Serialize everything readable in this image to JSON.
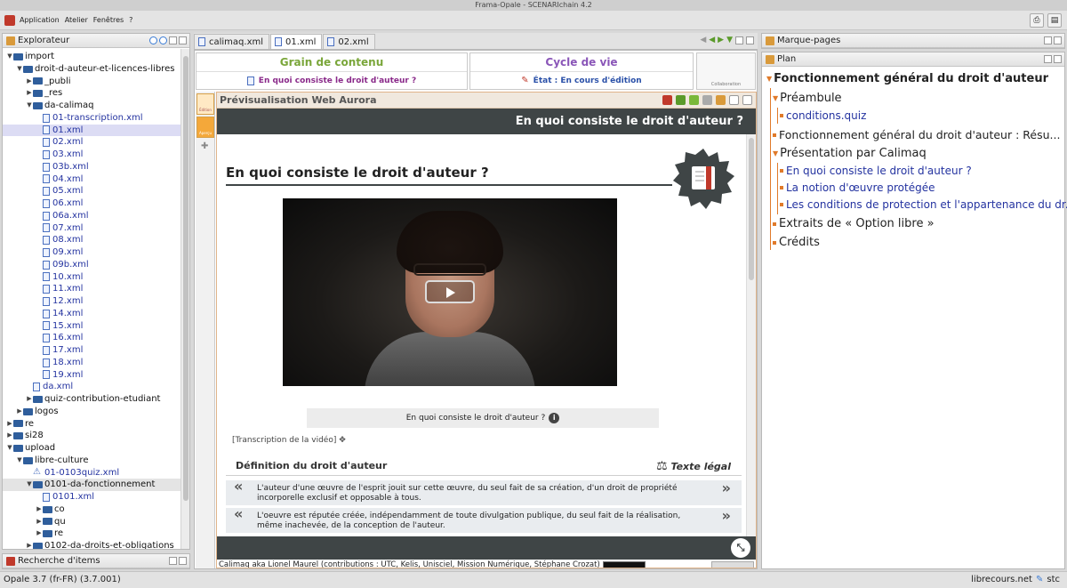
{
  "window": {
    "title": "Frama-Opale - SCENARIchain 4.2"
  },
  "menu": {
    "items": [
      "Application",
      "Atelier",
      "Fenêtres",
      "?"
    ]
  },
  "explorer": {
    "title": "Explorateur",
    "tree": [
      {
        "label": "import",
        "depth": 0,
        "type": "dir",
        "open": true
      },
      {
        "label": "droit-d-auteur-et-licences-libres",
        "depth": 1,
        "type": "dir",
        "open": true
      },
      {
        "label": "_publi",
        "depth": 2,
        "type": "dir",
        "open": false
      },
      {
        "label": "_res",
        "depth": 2,
        "type": "dir",
        "open": false
      },
      {
        "label": "da-calimaq",
        "depth": 2,
        "type": "dir",
        "open": true
      },
      {
        "label": "01-transcription.xml",
        "depth": 3,
        "type": "file"
      },
      {
        "label": "01.xml",
        "depth": 3,
        "type": "file",
        "selected": true
      },
      {
        "label": "02.xml",
        "depth": 3,
        "type": "file"
      },
      {
        "label": "03.xml",
        "depth": 3,
        "type": "file"
      },
      {
        "label": "03b.xml",
        "depth": 3,
        "type": "file"
      },
      {
        "label": "04.xml",
        "depth": 3,
        "type": "file"
      },
      {
        "label": "05.xml",
        "depth": 3,
        "type": "file"
      },
      {
        "label": "06.xml",
        "depth": 3,
        "type": "file"
      },
      {
        "label": "06a.xml",
        "depth": 3,
        "type": "file"
      },
      {
        "label": "07.xml",
        "depth": 3,
        "type": "file"
      },
      {
        "label": "08.xml",
        "depth": 3,
        "type": "file"
      },
      {
        "label": "09.xml",
        "depth": 3,
        "type": "file"
      },
      {
        "label": "09b.xml",
        "depth": 3,
        "type": "file"
      },
      {
        "label": "10.xml",
        "depth": 3,
        "type": "file"
      },
      {
        "label": "11.xml",
        "depth": 3,
        "type": "file"
      },
      {
        "label": "12.xml",
        "depth": 3,
        "type": "file"
      },
      {
        "label": "14.xml",
        "depth": 3,
        "type": "file"
      },
      {
        "label": "15.xml",
        "depth": 3,
        "type": "file"
      },
      {
        "label": "16.xml",
        "depth": 3,
        "type": "file"
      },
      {
        "label": "17.xml",
        "depth": 3,
        "type": "file"
      },
      {
        "label": "18.xml",
        "depth": 3,
        "type": "file"
      },
      {
        "label": "19.xml",
        "depth": 3,
        "type": "file"
      },
      {
        "label": "da.xml",
        "depth": 2,
        "type": "file"
      },
      {
        "label": "quiz-contribution-etudiant",
        "depth": 2,
        "type": "dir",
        "open": false
      },
      {
        "label": "logos",
        "depth": 1,
        "type": "dir",
        "open": false
      },
      {
        "label": "re",
        "depth": 0,
        "type": "dir",
        "open": false
      },
      {
        "label": "si28",
        "depth": 0,
        "type": "dir",
        "open": false
      },
      {
        "label": "upload",
        "depth": 0,
        "type": "dir",
        "open": true
      },
      {
        "label": "libre-culture",
        "depth": 1,
        "type": "dir",
        "open": true
      },
      {
        "label": "01-0103quiz.xml",
        "depth": 2,
        "type": "quiz"
      },
      {
        "label": "0101-da-fonctionnement",
        "depth": 2,
        "type": "dir",
        "open": true,
        "hover": true
      },
      {
        "label": "0101.xml",
        "depth": 3,
        "type": "file"
      },
      {
        "label": "co",
        "depth": 3,
        "type": "dir",
        "open": false
      },
      {
        "label": "qu",
        "depth": 3,
        "type": "dir",
        "open": false
      },
      {
        "label": "re",
        "depth": 3,
        "type": "dir",
        "open": false
      },
      {
        "label": "0102-da-droits-et-obligations",
        "depth": 2,
        "type": "dir",
        "open": false
      }
    ]
  },
  "search_panel": {
    "title": "Recherche d'items"
  },
  "tabs": [
    {
      "label": "calimaq.xml",
      "active": false
    },
    {
      "label": "01.xml",
      "active": true
    },
    {
      "label": "02.xml",
      "active": false
    }
  ],
  "header": {
    "grain_label": "Grain de contenu",
    "grain_value": "En quoi consiste le droit d'auteur ?",
    "cycle_label": "Cycle de vie",
    "cycle_value": "État : En cours d'édition",
    "collab_label": "Collaboration"
  },
  "sidetools": {
    "edit": "Édition",
    "preview": "Aperçu"
  },
  "preview": {
    "title": "Prévisualisation Web Aurora",
    "banner": "En quoi consiste le droit d'auteur ?",
    "content_title": "En quoi consiste le droit d'auteur ?",
    "video_caption": "En quoi consiste le droit d'auteur ?",
    "info_glyph": "i",
    "transcription_link": "[Transcription de la vidéo]",
    "def_title": "Définition du droit d'auteur",
    "legal_label": "Texte légal",
    "quotes": [
      "L'auteur d'une œuvre de l'esprit jouit sur cette œuvre, du seul fait de sa création, d'un droit de propriété incorporelle exclusif et opposable à tous.",
      "L'oeuvre est réputée créée, indépendamment de toute divulgation publique, du seul fait de la réalisation, même inachevée, de la conception de l'auteur."
    ],
    "credits": "Calimaq aka Lionel Maurel (contributions : UTC, Kelis, Unisciel, Mission Numérique, Stéphane Crozat)"
  },
  "bookmarks": {
    "title": "Marque-pages"
  },
  "plan": {
    "title": "Plan",
    "root": "Fonctionnement général du droit d'auteur",
    "items": [
      {
        "label": "Préambule",
        "level": 1,
        "open": true
      },
      {
        "label": "conditions.quiz",
        "level": 2
      },
      {
        "label": "Fonctionnement général du droit d'auteur : Résu...",
        "level": 1
      },
      {
        "label": "Présentation par Calimaq",
        "level": 1,
        "open": true
      },
      {
        "label": "En quoi consiste le droit d'auteur ?",
        "level": 2,
        "current": true
      },
      {
        "label": "La notion d'œuvre protégée",
        "level": 2
      },
      {
        "label": "Les conditions de protection et l'appartenance du dr...",
        "level": 2
      },
      {
        "label": "Extraits de « Option libre »",
        "level": 1
      },
      {
        "label": "Crédits",
        "level": 1
      }
    ]
  },
  "status": {
    "left": "Opale 3.7 (fr-FR) (3.7.001)",
    "right": "librecours.net",
    "user": "stc"
  },
  "colors": {
    "accent_green": "#7aa63a",
    "accent_purple": "#8a56b8",
    "orange": "#e07a2a",
    "dark_bar": "#3f4546"
  }
}
